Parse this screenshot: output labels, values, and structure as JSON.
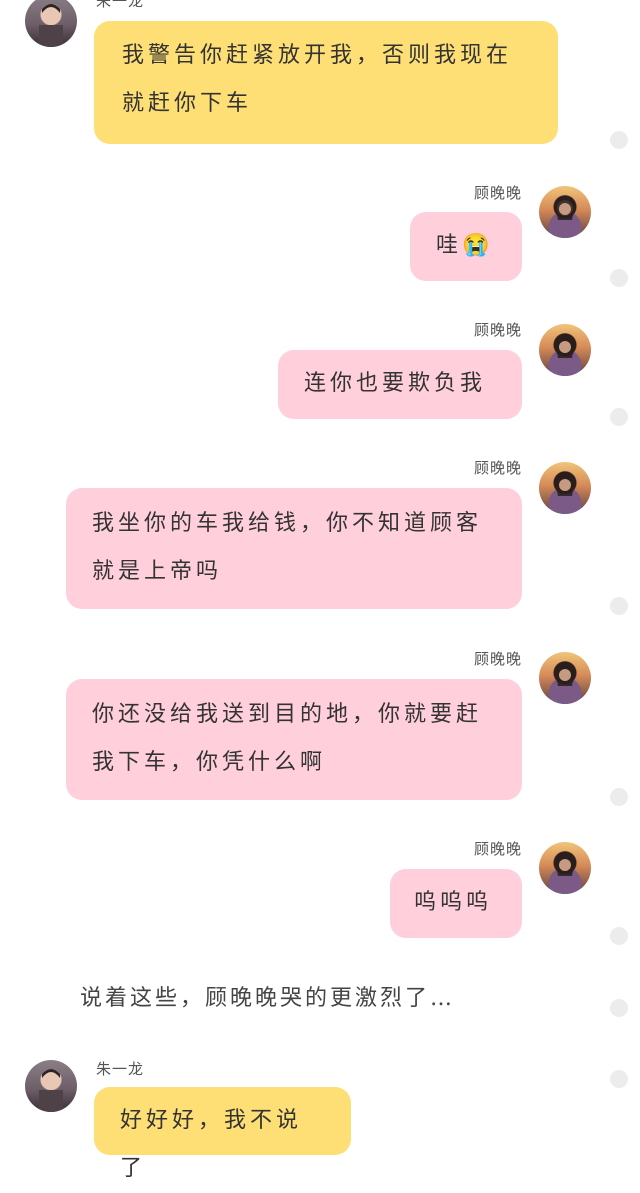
{
  "names": {
    "male": "朱一龙",
    "female": "顾晚晚"
  },
  "messages": [
    {
      "sender": "朱一龙",
      "side": "left",
      "color": "yellow",
      "line1": "我警告你赶紧放开我，否则我现在",
      "line2": "就赶你下车"
    },
    {
      "sender": "顾晚晚",
      "side": "right",
      "color": "pink",
      "line1": "哇😭",
      "line2": ""
    },
    {
      "sender": "顾晚晚",
      "side": "right",
      "color": "pink",
      "line1": "连你也要欺负我",
      "line2": ""
    },
    {
      "sender": "顾晚晚",
      "side": "right",
      "color": "pink",
      "line1": "我坐你的车我给钱，你不知道顾客",
      "line2": "就是上帝吗"
    },
    {
      "sender": "顾晚晚",
      "side": "right",
      "color": "pink",
      "line1": "你还没给我送到目的地，你就要赶",
      "line2": "我下车，你凭什么啊"
    },
    {
      "sender": "顾晚晚",
      "side": "right",
      "color": "pink",
      "line1": "呜呜呜",
      "line2": ""
    },
    {
      "sender": "朱一龙",
      "side": "left",
      "color": "yellow",
      "line1": "好好好，我不说了",
      "line2": ""
    }
  ],
  "narration": "说着这些，顾晚晚哭的更激烈了…",
  "colors": {
    "yellow_bubble": "#fedf75",
    "pink_bubble": "#ffcfdc",
    "background": "#ffffff"
  }
}
